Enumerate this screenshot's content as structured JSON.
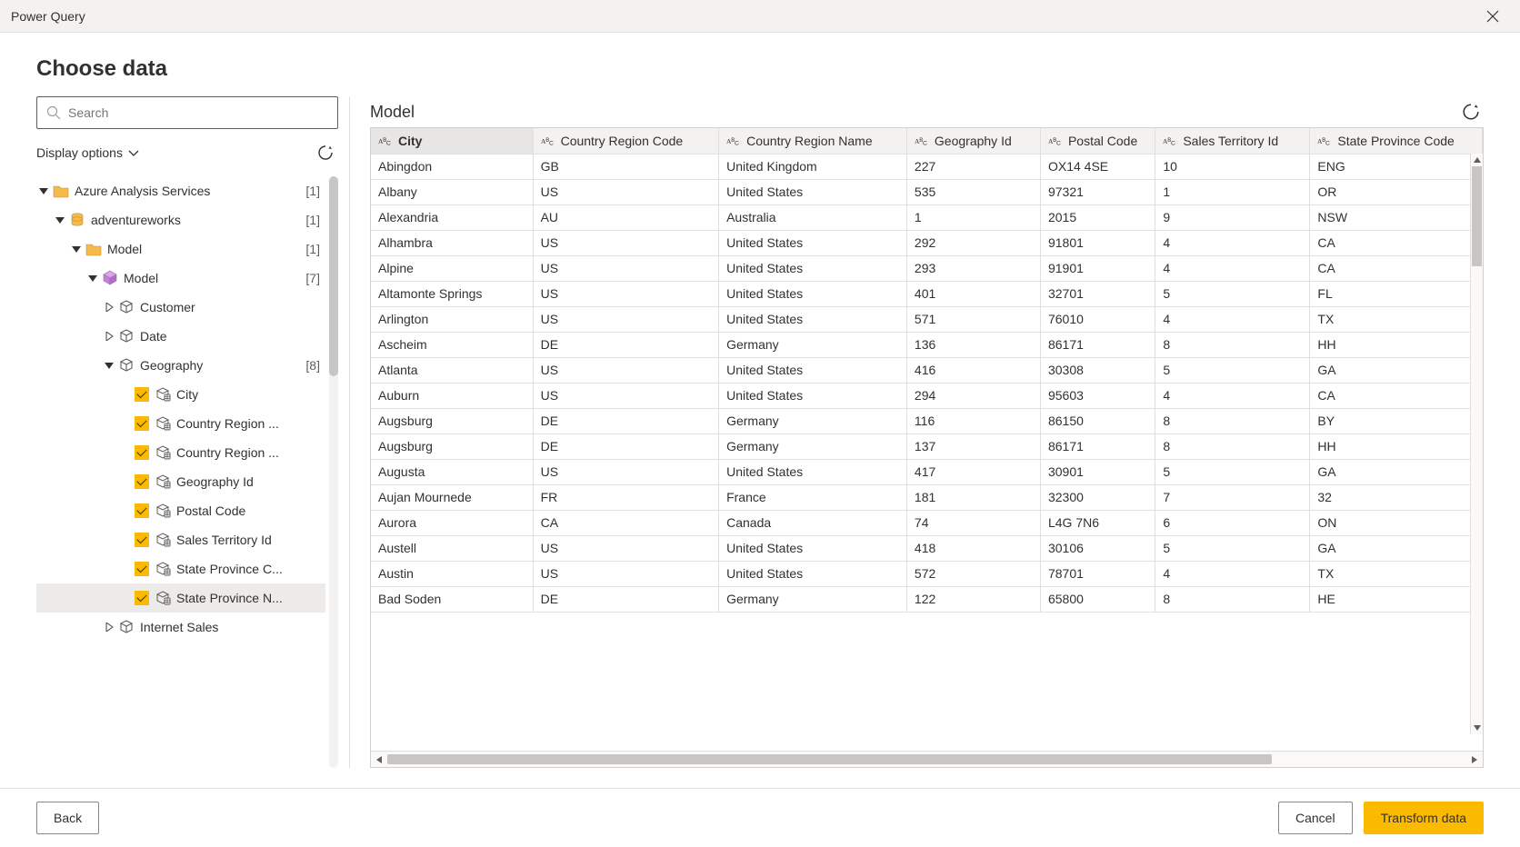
{
  "window": {
    "title": "Power Query"
  },
  "heading": "Choose data",
  "search": {
    "placeholder": "Search"
  },
  "display_options": {
    "label": "Display options"
  },
  "tree": [
    {
      "id": "aas",
      "indent": 0,
      "expander": "down",
      "icon": "folder",
      "check": false,
      "label": "Azure Analysis Services",
      "count": "[1]"
    },
    {
      "id": "db",
      "indent": 1,
      "expander": "down",
      "icon": "database",
      "check": false,
      "label": "adventureworks",
      "count": "[1]"
    },
    {
      "id": "mfold",
      "indent": 2,
      "expander": "down",
      "icon": "folder",
      "check": false,
      "label": "Model",
      "count": "[1]"
    },
    {
      "id": "mcube",
      "indent": 3,
      "expander": "down",
      "icon": "cube",
      "check": false,
      "label": "Model",
      "count": "[7]"
    },
    {
      "id": "cust",
      "indent": 4,
      "expander": "right",
      "icon": "table",
      "check": false,
      "label": "Customer",
      "count": ""
    },
    {
      "id": "date",
      "indent": 4,
      "expander": "right",
      "icon": "table",
      "check": false,
      "label": "Date",
      "count": ""
    },
    {
      "id": "geo",
      "indent": 4,
      "expander": "down",
      "icon": "table",
      "check": false,
      "label": "Geography",
      "count": "[8]"
    },
    {
      "id": "c0",
      "indent": 5,
      "expander": "",
      "icon": "column",
      "check": true,
      "label": "City",
      "count": ""
    },
    {
      "id": "c1",
      "indent": 5,
      "expander": "",
      "icon": "column",
      "check": true,
      "label": "Country Region ...",
      "count": ""
    },
    {
      "id": "c2",
      "indent": 5,
      "expander": "",
      "icon": "column",
      "check": true,
      "label": "Country Region ...",
      "count": ""
    },
    {
      "id": "c3",
      "indent": 5,
      "expander": "",
      "icon": "column",
      "check": true,
      "label": "Geography Id",
      "count": ""
    },
    {
      "id": "c4",
      "indent": 5,
      "expander": "",
      "icon": "column",
      "check": true,
      "label": "Postal Code",
      "count": ""
    },
    {
      "id": "c5",
      "indent": 5,
      "expander": "",
      "icon": "column",
      "check": true,
      "label": "Sales Territory Id",
      "count": ""
    },
    {
      "id": "c6",
      "indent": 5,
      "expander": "",
      "icon": "column",
      "check": true,
      "label": "State Province C...",
      "count": ""
    },
    {
      "id": "c7",
      "indent": 5,
      "expander": "",
      "icon": "column",
      "check": true,
      "label": "State Province N...",
      "count": "",
      "selected": true
    },
    {
      "id": "is",
      "indent": 4,
      "expander": "right",
      "icon": "table",
      "check": false,
      "label": "Internet Sales",
      "count": ""
    }
  ],
  "preview": {
    "title": "Model"
  },
  "columns": [
    "City",
    "Country Region Code",
    "Country Region Name",
    "Geography Id",
    "Postal Code",
    "Sales Territory Id",
    "State Province Code"
  ],
  "rows": [
    [
      "Abingdon",
      "GB",
      "United Kingdom",
      "227",
      "OX14 4SE",
      "10",
      "ENG"
    ],
    [
      "Albany",
      "US",
      "United States",
      "535",
      "97321",
      "1",
      "OR"
    ],
    [
      "Alexandria",
      "AU",
      "Australia",
      "1",
      "2015",
      "9",
      "NSW"
    ],
    [
      "Alhambra",
      "US",
      "United States",
      "292",
      "91801",
      "4",
      "CA"
    ],
    [
      "Alpine",
      "US",
      "United States",
      "293",
      "91901",
      "4",
      "CA"
    ],
    [
      "Altamonte Springs",
      "US",
      "United States",
      "401",
      "32701",
      "5",
      "FL"
    ],
    [
      "Arlington",
      "US",
      "United States",
      "571",
      "76010",
      "4",
      "TX"
    ],
    [
      "Ascheim",
      "DE",
      "Germany",
      "136",
      "86171",
      "8",
      "HH"
    ],
    [
      "Atlanta",
      "US",
      "United States",
      "416",
      "30308",
      "5",
      "GA"
    ],
    [
      "Auburn",
      "US",
      "United States",
      "294",
      "95603",
      "4",
      "CA"
    ],
    [
      "Augsburg",
      "DE",
      "Germany",
      "116",
      "86150",
      "8",
      "BY"
    ],
    [
      "Augsburg",
      "DE",
      "Germany",
      "137",
      "86171",
      "8",
      "HH"
    ],
    [
      "Augusta",
      "US",
      "United States",
      "417",
      "30901",
      "5",
      "GA"
    ],
    [
      "Aujan Mournede",
      "FR",
      "France",
      "181",
      "32300",
      "7",
      "32"
    ],
    [
      "Aurora",
      "CA",
      "Canada",
      "74",
      "L4G 7N6",
      "6",
      "ON"
    ],
    [
      "Austell",
      "US",
      "United States",
      "418",
      "30106",
      "5",
      "GA"
    ],
    [
      "Austin",
      "US",
      "United States",
      "572",
      "78701",
      "4",
      "TX"
    ],
    [
      "Bad Soden",
      "DE",
      "Germany",
      "122",
      "65800",
      "8",
      "HE"
    ]
  ],
  "footer": {
    "back": "Back",
    "cancel": "Cancel",
    "transform": "Transform data"
  }
}
